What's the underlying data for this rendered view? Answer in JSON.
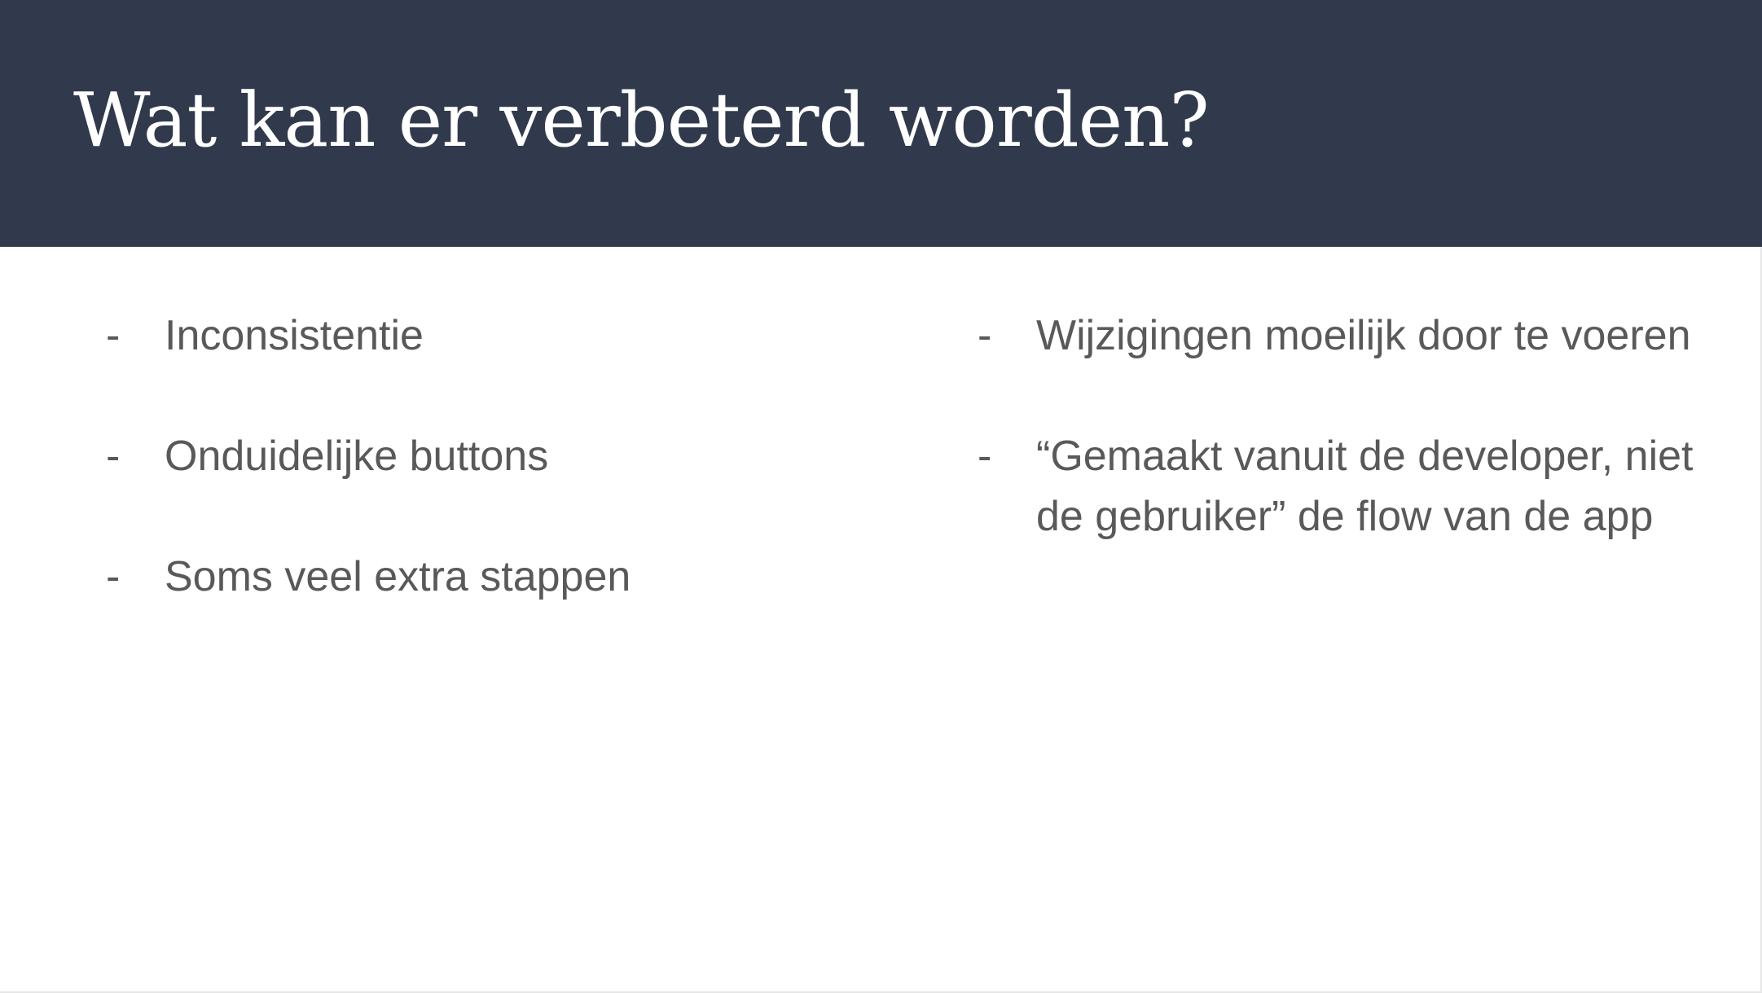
{
  "slide": {
    "title": "Wat kan er verbeterd worden?",
    "bullet_marker": "-",
    "left_column": [
      "Inconsistentie",
      "Onduidelijke buttons",
      "Soms veel extra stappen"
    ],
    "right_column": [
      "Wijzigingen moeilijk door te voeren",
      "“Gemaakt vanuit de developer, niet de gebruiker” de flow van de app"
    ]
  },
  "colors": {
    "header_background": "#313a4c",
    "title_text": "#ffffff",
    "body_text": "#595959",
    "slide_background": "#ffffff"
  }
}
